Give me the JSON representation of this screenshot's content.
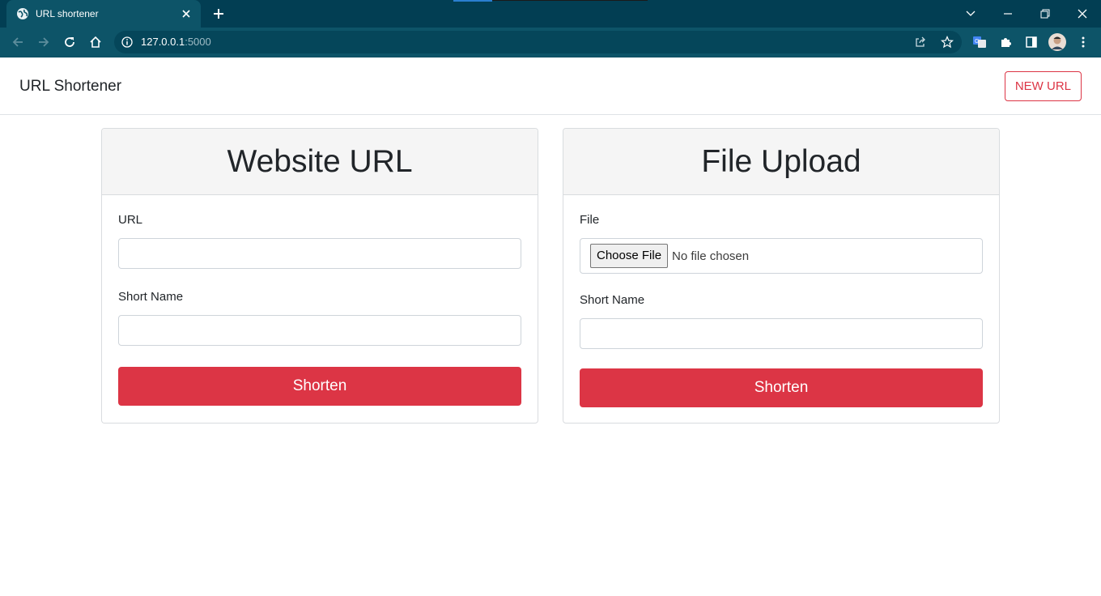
{
  "browser": {
    "tab_title": "URL shortener",
    "url_host": "127.0.0.1",
    "url_port": ":5000",
    "icons": [
      "globe-icon",
      "close-icon",
      "plus-icon",
      "chevron-down-icon",
      "minimize-icon",
      "restore-icon",
      "back-icon",
      "forward-icon",
      "reload-icon",
      "home-icon",
      "info-icon",
      "share-icon",
      "star-icon",
      "translate-icon",
      "puzzle-icon",
      "sidepanel-icon",
      "avatar",
      "kebab-menu-icon"
    ],
    "colors": {
      "titlebar": "#023e53",
      "toolbar": "#0d5468"
    }
  },
  "navbar": {
    "brand": "URL Shortener",
    "new_url_label": "NEW URL"
  },
  "website_card": {
    "title": "Website URL",
    "url_label": "URL",
    "url_value": "",
    "short_name_label": "Short Name",
    "short_name_value": "",
    "submit_label": "Shorten"
  },
  "file_card": {
    "title": "File Upload",
    "file_label": "File",
    "choose_file_label": "Choose File",
    "no_file_text": "No file chosen",
    "short_name_label": "Short Name",
    "short_name_value": "",
    "submit_label": "Shorten"
  },
  "colors": {
    "accent": "#dc3545",
    "card_header": "#f5f5f5",
    "border": "#d9dcdf"
  }
}
